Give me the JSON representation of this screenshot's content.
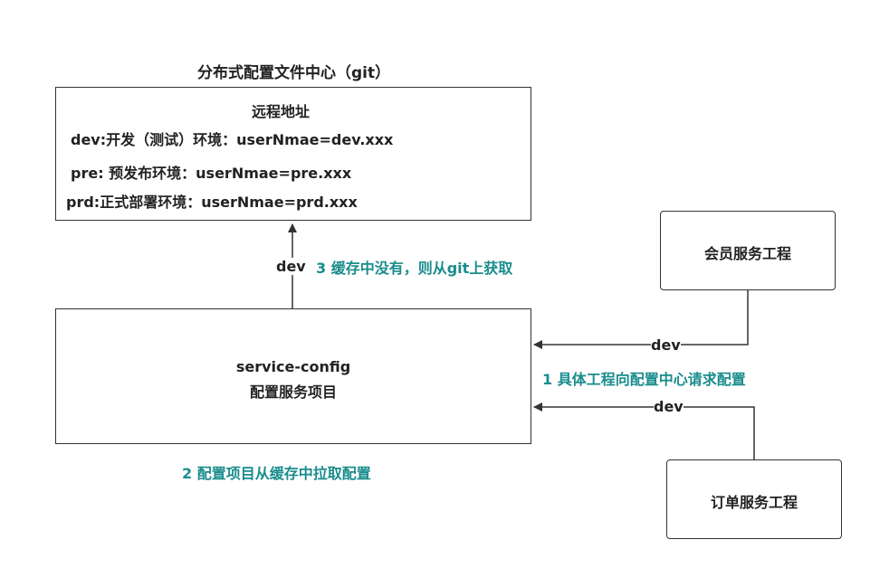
{
  "config_center": {
    "title": "分布式配置文件中心（git）",
    "heading": "远程地址",
    "lines": [
      "dev:开发（测试）环境：userNmae=dev.xxx",
      "pre: 预发布环境：userNmae=pre.xxx",
      "prd:正式部署环境：userNmae=prd.xxx"
    ]
  },
  "service_config": {
    "name": "service-config",
    "subtitle": "配置服务项目"
  },
  "member_service": {
    "label": "会员服务工程"
  },
  "order_service": {
    "label": "订单服务工程"
  },
  "edges": {
    "to_git_label": "dev",
    "member_label": "dev",
    "order_label": "dev"
  },
  "steps": {
    "step1": "1 具体工程向配置中心请求配置",
    "step2": "2 配置项目从缓存中拉取配置",
    "step3": "3 缓存中没有，则从git上获取"
  },
  "colors": {
    "accent": "#1a8c8c",
    "border": "#333333"
  }
}
